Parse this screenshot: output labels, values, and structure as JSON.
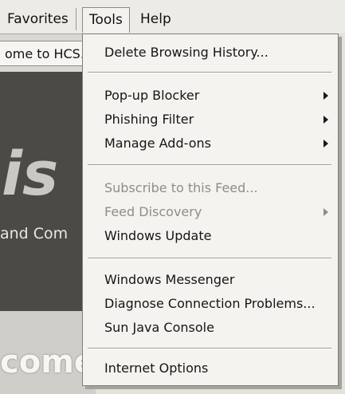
{
  "menubar": {
    "favorites": "Favorites",
    "tools": "Tools",
    "help": "Help"
  },
  "tab": {
    "title": "ome to HCS."
  },
  "page": {
    "logo": "is",
    "subtitle": "and Com",
    "welcome": "come"
  },
  "tools_menu": {
    "items": [
      {
        "label": "Delete Browsing History..."
      },
      {
        "label": "Pop-up Blocker"
      },
      {
        "label": "Phishing Filter"
      },
      {
        "label": "Manage Add-ons"
      },
      {
        "label": "Subscribe to this Feed..."
      },
      {
        "label": "Feed Discovery"
      },
      {
        "label": "Windows Update"
      },
      {
        "label": "Windows Messenger"
      },
      {
        "label": "Diagnose Connection Problems..."
      },
      {
        "label": "Sun Java Console"
      },
      {
        "label": "Internet Options"
      }
    ]
  }
}
